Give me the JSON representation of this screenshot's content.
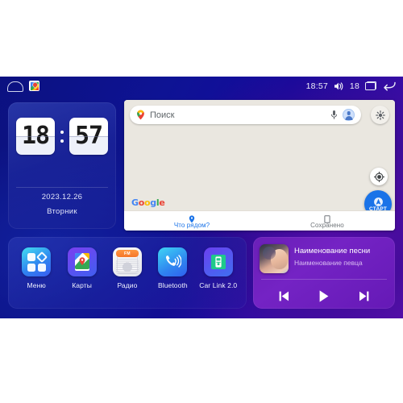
{
  "statusbar": {
    "home_icon": "home-icon",
    "maps_icon": "google-maps-icon",
    "time": "18:57",
    "volume_icon": "speaker-icon",
    "volume_value": "18",
    "recents_icon": "recent-apps-icon",
    "back_icon": "back-arrow-icon"
  },
  "clock_widget": {
    "hours": "18",
    "minutes": "57",
    "date": "2023.12.26",
    "weekday": "Вторник"
  },
  "map_widget": {
    "search": {
      "placeholder": "Поиск",
      "pin_icon": "map-pin-icon",
      "mic_icon": "microphone-icon",
      "avatar_icon": "account-avatar-icon"
    },
    "layers_icon": "map-settings-icon",
    "locate_icon": "my-location-icon",
    "start_button": {
      "label": "СТАРТ",
      "icon": "navigation-arrow-icon"
    },
    "attribution": "Google",
    "tabs": [
      {
        "label": "Что рядом?",
        "icon": "pin-icon",
        "active": true
      },
      {
        "label": "Сохранено",
        "icon": "bookmark-icon",
        "active": false
      }
    ]
  },
  "app_dock": {
    "apps": [
      {
        "name": "Меню",
        "icon": "apps-grid-icon"
      },
      {
        "name": "Карты",
        "icon": "google-maps-icon"
      },
      {
        "name": "Радио",
        "icon": "fm-radio-icon",
        "band": "FM"
      },
      {
        "name": "Bluetooth",
        "icon": "bluetooth-phone-icon"
      },
      {
        "name": "Car Link 2.0",
        "icon": "car-link-icon"
      }
    ]
  },
  "music_widget": {
    "album_art": "album-art-portrait",
    "title": "Наименование песни",
    "artist": "Наименование певца",
    "controls": [
      {
        "name": "previous",
        "icon": "skip-previous-icon"
      },
      {
        "name": "play",
        "icon": "play-icon"
      },
      {
        "name": "next",
        "icon": "skip-next-icon"
      }
    ]
  },
  "colors": {
    "accent_blue": "#1a73e8",
    "bg_blue": "#0e1394",
    "bg_purple": "#5a10b0",
    "music_purple": "#7423c4",
    "map_bg": "#eae7e0"
  }
}
